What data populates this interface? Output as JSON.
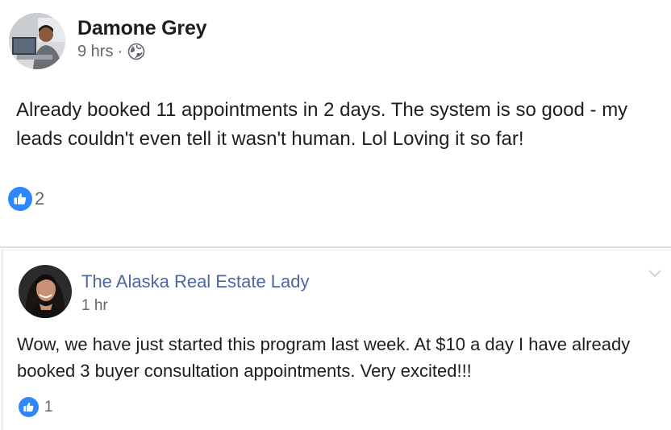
{
  "post": {
    "author": "Damone Grey",
    "time": "9 hrs",
    "separator": "·",
    "privacy_icon": "globe-icon",
    "text": "Already booked 11 appointments in 2 days. The system is so good - my leads couldn't even tell it wasn't human. Lol Loving it so far!",
    "reaction_icon": "like-icon",
    "reaction_count": "2"
  },
  "comment": {
    "author": "The Alaska Real Estate Lady",
    "time": "1 hr",
    "text": "Wow, we have just started this program last week. At $10 a day I have already booked 3 buyer consultation appointments. Very excited!!!",
    "reaction_icon": "like-icon",
    "reaction_count": "1",
    "menu_icon": "chevron-down-icon"
  },
  "colors": {
    "link_blue": "#4b67a1",
    "like_blue": "#2d88ff",
    "secondary_text": "#606770",
    "primary_text": "#1c1e21",
    "divider": "#dddfe2"
  }
}
